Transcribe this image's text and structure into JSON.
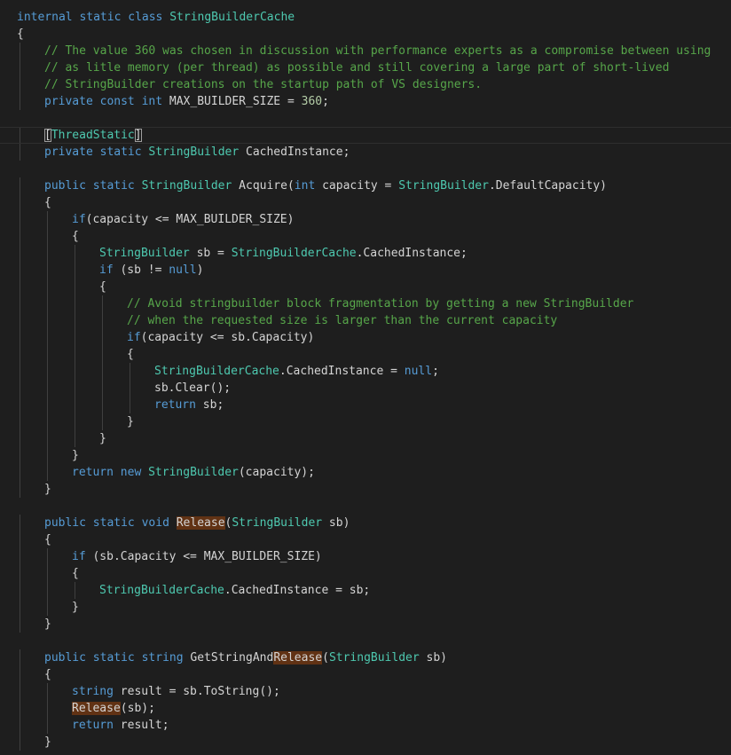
{
  "editor": {
    "lines": [
      {
        "indent": 0,
        "tokens": [
          {
            "t": "internal",
            "c": "kw"
          },
          {
            "t": " "
          },
          {
            "t": "static",
            "c": "kw"
          },
          {
            "t": " "
          },
          {
            "t": "class",
            "c": "kw"
          },
          {
            "t": " "
          },
          {
            "t": "StringBuilderCache",
            "c": "type"
          }
        ]
      },
      {
        "indent": 0,
        "tokens": [
          {
            "t": "{"
          }
        ]
      },
      {
        "indent": 1,
        "tokens": [
          {
            "t": "// The value 360 was chosen in discussion with performance experts as a compromise between using",
            "c": "cmt"
          }
        ]
      },
      {
        "indent": 1,
        "tokens": [
          {
            "t": "// as litle memory (per thread) as possible and still covering a large part of short-lived",
            "c": "cmt"
          }
        ]
      },
      {
        "indent": 1,
        "tokens": [
          {
            "t": "// StringBuilder creations on the startup path of VS designers.",
            "c": "cmt"
          }
        ]
      },
      {
        "indent": 1,
        "tokens": [
          {
            "t": "private",
            "c": "kw"
          },
          {
            "t": " "
          },
          {
            "t": "const",
            "c": "kw"
          },
          {
            "t": " "
          },
          {
            "t": "int",
            "c": "kw"
          },
          {
            "t": " MAX_BUILDER_SIZE = "
          },
          {
            "t": "360",
            "c": "num"
          },
          {
            "t": ";"
          }
        ]
      },
      {
        "indent": 0,
        "tokens": []
      },
      {
        "indent": 1,
        "current": true,
        "tokens": [
          {
            "t": "[",
            "c": "bracket"
          },
          {
            "t": "ThreadStatic",
            "c": "type"
          },
          {
            "t": "]",
            "c": "bracket"
          }
        ]
      },
      {
        "indent": 1,
        "tokens": [
          {
            "t": "private",
            "c": "kw"
          },
          {
            "t": " "
          },
          {
            "t": "static",
            "c": "kw"
          },
          {
            "t": " "
          },
          {
            "t": "StringBuilder",
            "c": "type"
          },
          {
            "t": " CachedInstance;"
          }
        ]
      },
      {
        "indent": 0,
        "tokens": []
      },
      {
        "indent": 1,
        "tokens": [
          {
            "t": "public",
            "c": "kw"
          },
          {
            "t": " "
          },
          {
            "t": "static",
            "c": "kw"
          },
          {
            "t": " "
          },
          {
            "t": "StringBuilder",
            "c": "type"
          },
          {
            "t": " Acquire("
          },
          {
            "t": "int",
            "c": "kw"
          },
          {
            "t": " capacity = "
          },
          {
            "t": "StringBuilder",
            "c": "type"
          },
          {
            "t": ".DefaultCapacity)"
          }
        ]
      },
      {
        "indent": 1,
        "tokens": [
          {
            "t": "{"
          }
        ]
      },
      {
        "indent": 2,
        "tokens": [
          {
            "t": "if",
            "c": "kw"
          },
          {
            "t": "(capacity <= MAX_BUILDER_SIZE)"
          }
        ]
      },
      {
        "indent": 2,
        "tokens": [
          {
            "t": "{"
          }
        ]
      },
      {
        "indent": 3,
        "tokens": [
          {
            "t": "StringBuilder",
            "c": "type"
          },
          {
            "t": " sb = "
          },
          {
            "t": "StringBuilderCache",
            "c": "type"
          },
          {
            "t": ".CachedInstance;"
          }
        ]
      },
      {
        "indent": 3,
        "tokens": [
          {
            "t": "if",
            "c": "kw"
          },
          {
            "t": " (sb != "
          },
          {
            "t": "null",
            "c": "kw"
          },
          {
            "t": ")"
          }
        ]
      },
      {
        "indent": 3,
        "tokens": [
          {
            "t": "{"
          }
        ]
      },
      {
        "indent": 4,
        "tokens": [
          {
            "t": "// Avoid stringbuilder block fragmentation by getting a new StringBuilder",
            "c": "cmt"
          }
        ]
      },
      {
        "indent": 4,
        "tokens": [
          {
            "t": "// when the requested size is larger than the current capacity",
            "c": "cmt"
          }
        ]
      },
      {
        "indent": 4,
        "tokens": [
          {
            "t": "if",
            "c": "kw"
          },
          {
            "t": "(capacity <= sb.Capacity)"
          }
        ]
      },
      {
        "indent": 4,
        "tokens": [
          {
            "t": "{"
          }
        ]
      },
      {
        "indent": 5,
        "tokens": [
          {
            "t": "StringBuilderCache",
            "c": "type"
          },
          {
            "t": ".CachedInstance = "
          },
          {
            "t": "null",
            "c": "kw"
          },
          {
            "t": ";"
          }
        ]
      },
      {
        "indent": 5,
        "tokens": [
          {
            "t": "sb.Clear();"
          }
        ]
      },
      {
        "indent": 5,
        "tokens": [
          {
            "t": "return",
            "c": "kw"
          },
          {
            "t": " sb;"
          }
        ]
      },
      {
        "indent": 4,
        "tokens": [
          {
            "t": "}"
          }
        ]
      },
      {
        "indent": 3,
        "tokens": [
          {
            "t": "}"
          }
        ]
      },
      {
        "indent": 2,
        "tokens": [
          {
            "t": "}"
          }
        ]
      },
      {
        "indent": 2,
        "tokens": [
          {
            "t": "return",
            "c": "kw"
          },
          {
            "t": " "
          },
          {
            "t": "new",
            "c": "kw"
          },
          {
            "t": " "
          },
          {
            "t": "StringBuilder",
            "c": "type"
          },
          {
            "t": "(capacity);"
          }
        ]
      },
      {
        "indent": 1,
        "tokens": [
          {
            "t": "}"
          }
        ]
      },
      {
        "indent": 0,
        "tokens": []
      },
      {
        "indent": 1,
        "tokens": [
          {
            "t": "public",
            "c": "kw"
          },
          {
            "t": " "
          },
          {
            "t": "static",
            "c": "kw"
          },
          {
            "t": " "
          },
          {
            "t": "void",
            "c": "kw"
          },
          {
            "t": " "
          },
          {
            "t": "Release",
            "c": "hl"
          },
          {
            "t": "("
          },
          {
            "t": "StringBuilder",
            "c": "type"
          },
          {
            "t": " sb)"
          }
        ]
      },
      {
        "indent": 1,
        "tokens": [
          {
            "t": "{"
          }
        ]
      },
      {
        "indent": 2,
        "tokens": [
          {
            "t": "if",
            "c": "kw"
          },
          {
            "t": " (sb.Capacity <= MAX_BUILDER_SIZE)"
          }
        ]
      },
      {
        "indent": 2,
        "tokens": [
          {
            "t": "{"
          }
        ]
      },
      {
        "indent": 3,
        "tokens": [
          {
            "t": "StringBuilderCache",
            "c": "type"
          },
          {
            "t": ".CachedInstance = sb;"
          }
        ]
      },
      {
        "indent": 2,
        "tokens": [
          {
            "t": "}"
          }
        ]
      },
      {
        "indent": 1,
        "tokens": [
          {
            "t": "}"
          }
        ]
      },
      {
        "indent": 0,
        "tokens": []
      },
      {
        "indent": 1,
        "tokens": [
          {
            "t": "public",
            "c": "kw"
          },
          {
            "t": " "
          },
          {
            "t": "static",
            "c": "kw"
          },
          {
            "t": " "
          },
          {
            "t": "string",
            "c": "kw"
          },
          {
            "t": " GetStringAnd"
          },
          {
            "t": "Release",
            "c": "hl"
          },
          {
            "t": "("
          },
          {
            "t": "StringBuilder",
            "c": "type"
          },
          {
            "t": " sb)"
          }
        ]
      },
      {
        "indent": 1,
        "tokens": [
          {
            "t": "{"
          }
        ]
      },
      {
        "indent": 2,
        "tokens": [
          {
            "t": "string",
            "c": "kw"
          },
          {
            "t": " result = sb.ToString();"
          }
        ]
      },
      {
        "indent": 2,
        "tokens": [
          {
            "t": "Release",
            "c": "hl"
          },
          {
            "t": "(sb);"
          }
        ]
      },
      {
        "indent": 2,
        "tokens": [
          {
            "t": "return",
            "c": "kw"
          },
          {
            "t": " result;"
          }
        ]
      },
      {
        "indent": 1,
        "tokens": [
          {
            "t": "}"
          }
        ]
      }
    ],
    "colors": {
      "background": "#1e1e1e",
      "keyword": "#569cd6",
      "type": "#4ec9b0",
      "comment": "#57a64a",
      "number": "#b5cea8",
      "plain": "#d4d4d4",
      "highlight": "#613214"
    }
  }
}
